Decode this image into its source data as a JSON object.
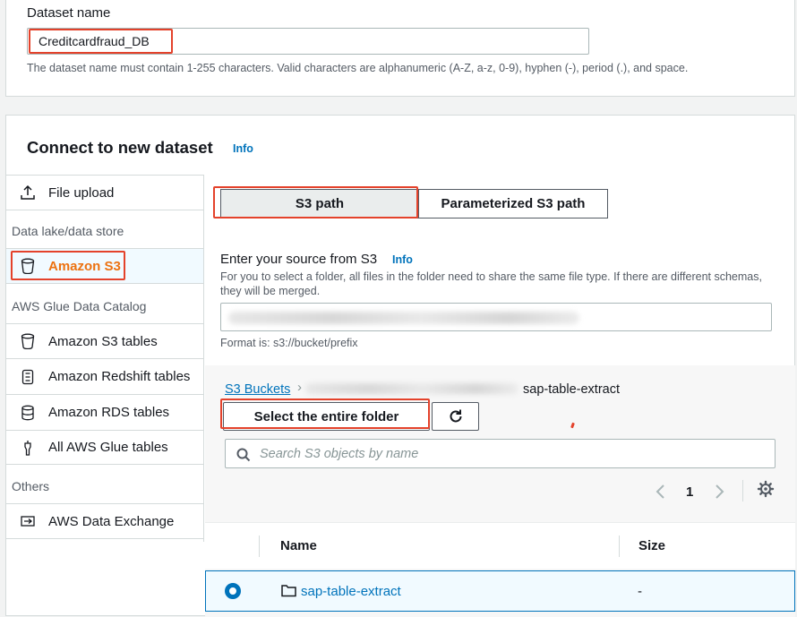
{
  "dataset": {
    "label": "Dataset name",
    "value": "Creditcardfraud_DB",
    "hint": "The dataset name must contain 1-255 characters. Valid characters are alphanumeric (A-Z, a-z, 0-9), hyphen (-), period (.), and space."
  },
  "connect": {
    "title": "Connect to new dataset",
    "info": "Info"
  },
  "nav": {
    "file_upload": "File upload",
    "group_lake": "Data lake/data store",
    "amazon_s3": "Amazon S3",
    "group_glue": "AWS Glue Data Catalog",
    "s3_tables": "Amazon S3 tables",
    "redshift_tables": "Amazon Redshift tables",
    "rds_tables": "Amazon RDS tables",
    "all_glue_tables": "All AWS Glue tables",
    "group_others": "Others",
    "data_exchange": "AWS Data Exchange"
  },
  "tabs": {
    "s3_path": "S3 path",
    "param_s3_path": "Parameterized S3 path"
  },
  "source": {
    "label": "Enter your source from S3",
    "info": "Info",
    "description": "For you to select a folder, all files in the folder need to share the same file type. If there are different schemas, they will be merged.",
    "format_hint": "Format is: s3://bucket/prefix"
  },
  "browser": {
    "crumb_root": "S3 Buckets",
    "crumb_current": "sap-table-extract",
    "select_folder": "Select the entire folder",
    "search_placeholder": "Search S3 objects by name",
    "page": "1"
  },
  "table": {
    "col_name": "Name",
    "col_size": "Size",
    "rows": [
      {
        "name": "sap-table-extract",
        "size": "-"
      }
    ]
  },
  "colors": {
    "accent": "#0073bb",
    "highlight": "#e4422b"
  }
}
